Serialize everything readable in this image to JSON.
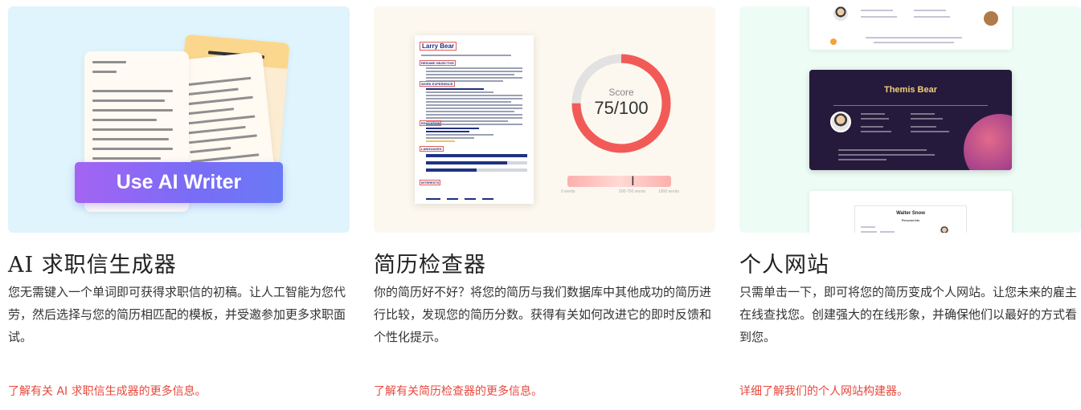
{
  "cards": [
    {
      "title": "AI 求职信生成器",
      "description": "您无需键入一个单词即可获得求职信的初稿。让人工智能为您代劳，然后选择与您的简历相匹配的模板，并受邀参加更多求职面试。",
      "link": "了解有关 AI 求职信生成器的更多信息。",
      "thumb": {
        "button_label": "Use AI Writer"
      }
    },
    {
      "title": "简历检查器",
      "description": "你的简历好不好？将您的简历与我们数据库中其他成功的简历进行比较，发现您的简历分数。获得有关如何改进它的即时反馈和个性化提示。",
      "link": "了解有关简历检查器的更多信息。",
      "thumb": {
        "resume_name": "Larry Bear",
        "sections": [
          "RESUME OBJECTIVE",
          "WORK EXPERIENCE",
          "EDUCATION",
          "LANGUAGES",
          "INTERESTS"
        ],
        "score_label": "Score",
        "score_value": "75/100",
        "score_fraction": 0.75,
        "slider_ticks": [
          "0 words",
          "500-700 words",
          "1000 words"
        ]
      }
    },
    {
      "title": "个人网站",
      "description": "只需单击一下，即可将您的简历变成个人网站。让您未来的雇主在线查找您。创建强大的在线形象，并确保他们以最好的方式看到您。",
      "link": "详细了解我们的个人网站构建器。",
      "thumb": {
        "site_dark_name": "Themis Bear",
        "site_light_name": "Walter Snow",
        "site_light_subtitle": "Personal Info"
      }
    }
  ],
  "colors": {
    "link": "#e8483c",
    "button_gradient_start": "#a464f2",
    "button_gradient_end": "#6a79f5",
    "score_ring": "#f25a58",
    "score_track": "#e2e2e2",
    "site_dark_bg": "#251a3c"
  }
}
